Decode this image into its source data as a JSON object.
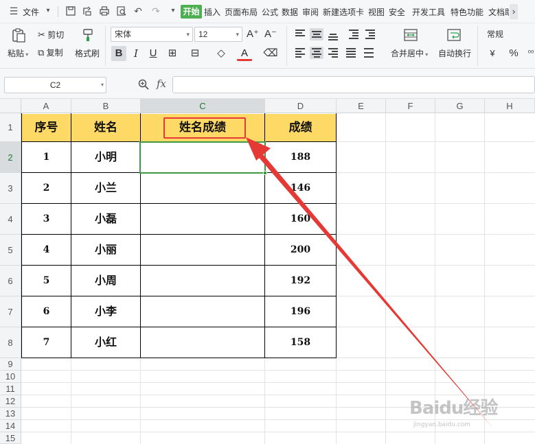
{
  "menubar": {
    "file_label": "文件",
    "tabs": [
      "开始",
      "插入",
      "页面布局",
      "公式",
      "数据",
      "审阅",
      "新建选项卡",
      "视图",
      "安全",
      "开发工具",
      "特色功能",
      "文档助"
    ],
    "more_arrow": "›"
  },
  "ribbon": {
    "paste_label": "粘贴",
    "cut_label": "剪切",
    "copy_label": "复制",
    "format_painter_label": "格式刷",
    "font_name": "宋体",
    "font_size": "12",
    "merge_center_label": "合并居中",
    "wrap_text_label": "自动换行",
    "number_format": "常规"
  },
  "formula_bar": {
    "cell_ref": "C2",
    "fx_label": "fx",
    "formula_value": ""
  },
  "sheet": {
    "columns": [
      "A",
      "B",
      "C",
      "D",
      "E",
      "F",
      "G",
      "H"
    ],
    "rows": [
      "1",
      "2",
      "3",
      "4",
      "5",
      "6",
      "7",
      "8",
      "9",
      "10",
      "11",
      "12",
      "13",
      "14",
      "15"
    ],
    "selected_cell": "C2",
    "table_header": [
      "序号",
      "姓名",
      "姓名成绩",
      "成绩"
    ],
    "table_rows": [
      [
        "1",
        "小明",
        "",
        "188"
      ],
      [
        "2",
        "小兰",
        "",
        "146"
      ],
      [
        "3",
        "小磊",
        "",
        "160"
      ],
      [
        "4",
        "小丽",
        "",
        "200"
      ],
      [
        "5",
        "小周",
        "",
        "192"
      ],
      [
        "6",
        "小李",
        "",
        "196"
      ],
      [
        "7",
        "小红",
        "",
        "158"
      ]
    ]
  },
  "watermark": {
    "main": "Baidu经验",
    "sub": "jingyan.baidu.com"
  },
  "colors": {
    "accent_green": "#4caf50",
    "header_fill": "#ffd966",
    "annotation_red": "#e53935"
  }
}
